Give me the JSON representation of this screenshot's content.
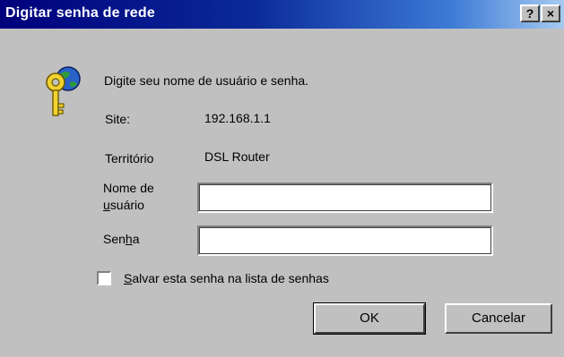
{
  "window": {
    "title": "Digitar senha de rede",
    "help_button": "?",
    "close_button": "×"
  },
  "prompt": "Digite seu nome de usuário e senha.",
  "site": {
    "label": "Site:",
    "value": "192.168.1.1"
  },
  "territory": {
    "label": "Território",
    "value": "DSL Router"
  },
  "username": {
    "label_line1": "Nome de",
    "label_accel": "u",
    "label_rest": "suário",
    "value": ""
  },
  "password": {
    "label_pre": "Sen",
    "label_accel": "h",
    "label_post": "a",
    "value": ""
  },
  "save_password": {
    "accel": "S",
    "label_rest": "alvar esta senha na lista de senhas",
    "checked": false
  },
  "buttons": {
    "ok": "OK",
    "cancel": "Cancelar"
  },
  "icons": {
    "key": "key-icon",
    "help": "help-icon",
    "close": "close-icon"
  }
}
